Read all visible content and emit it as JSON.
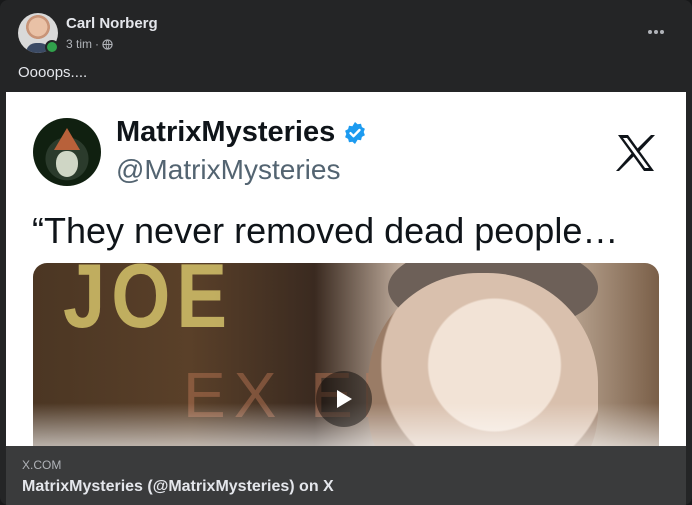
{
  "post": {
    "author": "Carl Norberg",
    "time": "3 tim",
    "time_separator": "·",
    "caption": "Oooops...."
  },
  "embed": {
    "display_name": "MatrixMysteries",
    "handle": "@MatrixMysteries",
    "quote": "“They never removed dead people…"
  },
  "link": {
    "domain": "X.COM",
    "title": "MatrixMysteries (@MatrixMysteries) on X"
  },
  "icons": {
    "privacy": "globe-icon",
    "menu": "more-options-icon",
    "verified": "verified-badge-icon",
    "brand": "x-logo-icon",
    "media": "play-icon"
  },
  "colors": {
    "background": "#242526",
    "text_primary": "#e4e6eb",
    "text_secondary": "#b0b3b8",
    "online": "#31a24c",
    "verified": "#1d9bf0",
    "link_area": "#3a3b3c"
  }
}
